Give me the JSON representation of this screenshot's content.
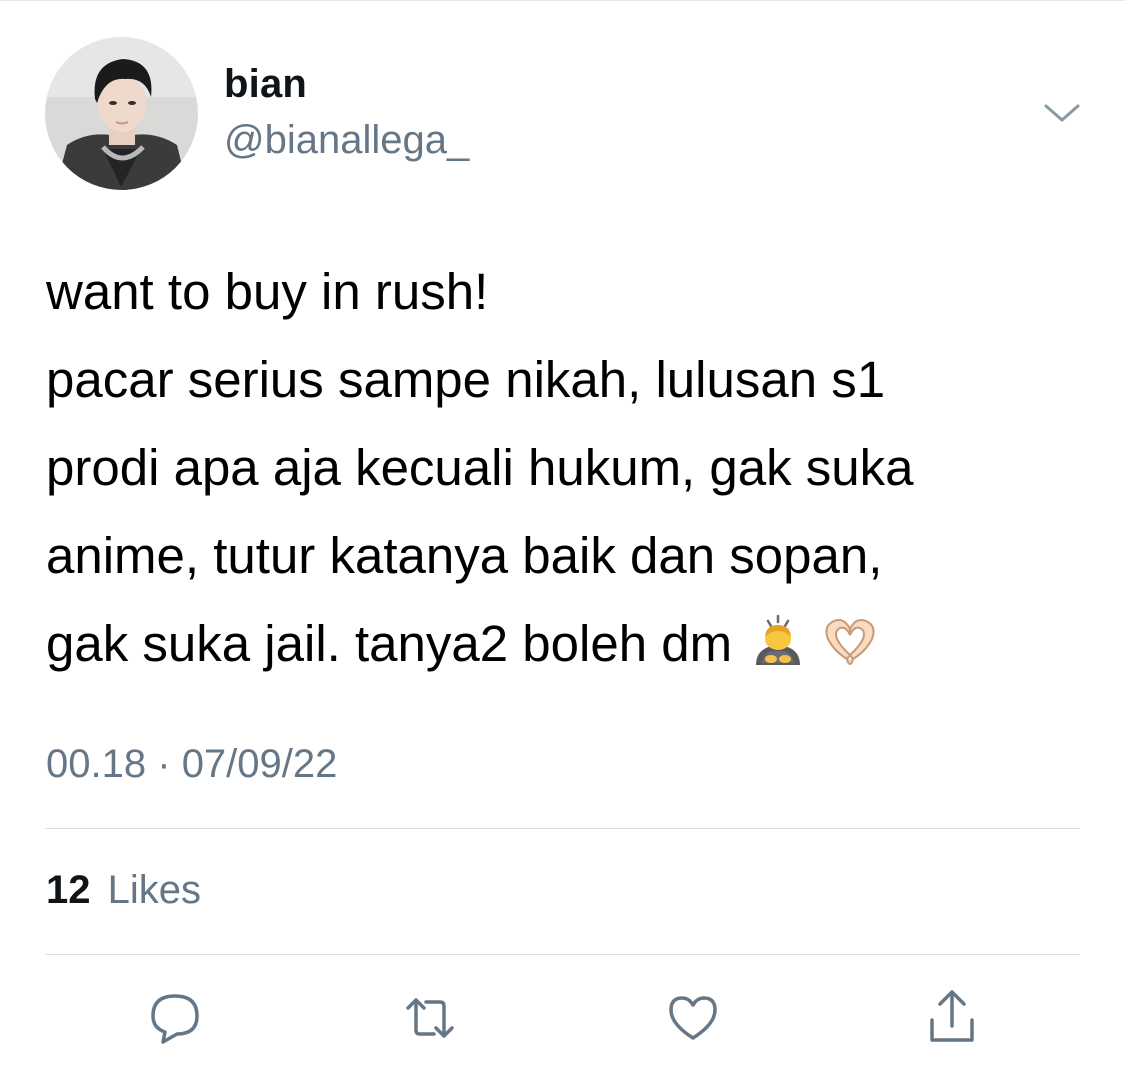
{
  "author": {
    "display_name": "bian",
    "handle": "@bianallega_"
  },
  "tweet": {
    "lines": [
      "want to buy in rush!",
      "pacar serius sampe nikah, lulusan s1",
      "prodi apa aja kecuali hukum, gak suka",
      "anime, tutur katanya baik dan sopan,",
      "gak suka jail. tanya2 boleh dm"
    ],
    "emojis": [
      "person-bowing-emoji",
      "heart-hands-emoji"
    ]
  },
  "meta": {
    "time": "00.18",
    "separator": "·",
    "date": "07/09/22"
  },
  "stats": {
    "likes_count": "12",
    "likes_label": "Likes"
  },
  "actions": [
    "reply-icon",
    "retweet-icon",
    "like-icon",
    "share-icon"
  ],
  "colors": {
    "primary_text": "#0f1419",
    "secondary_text": "#657786",
    "divider": "#dcdfe2"
  }
}
